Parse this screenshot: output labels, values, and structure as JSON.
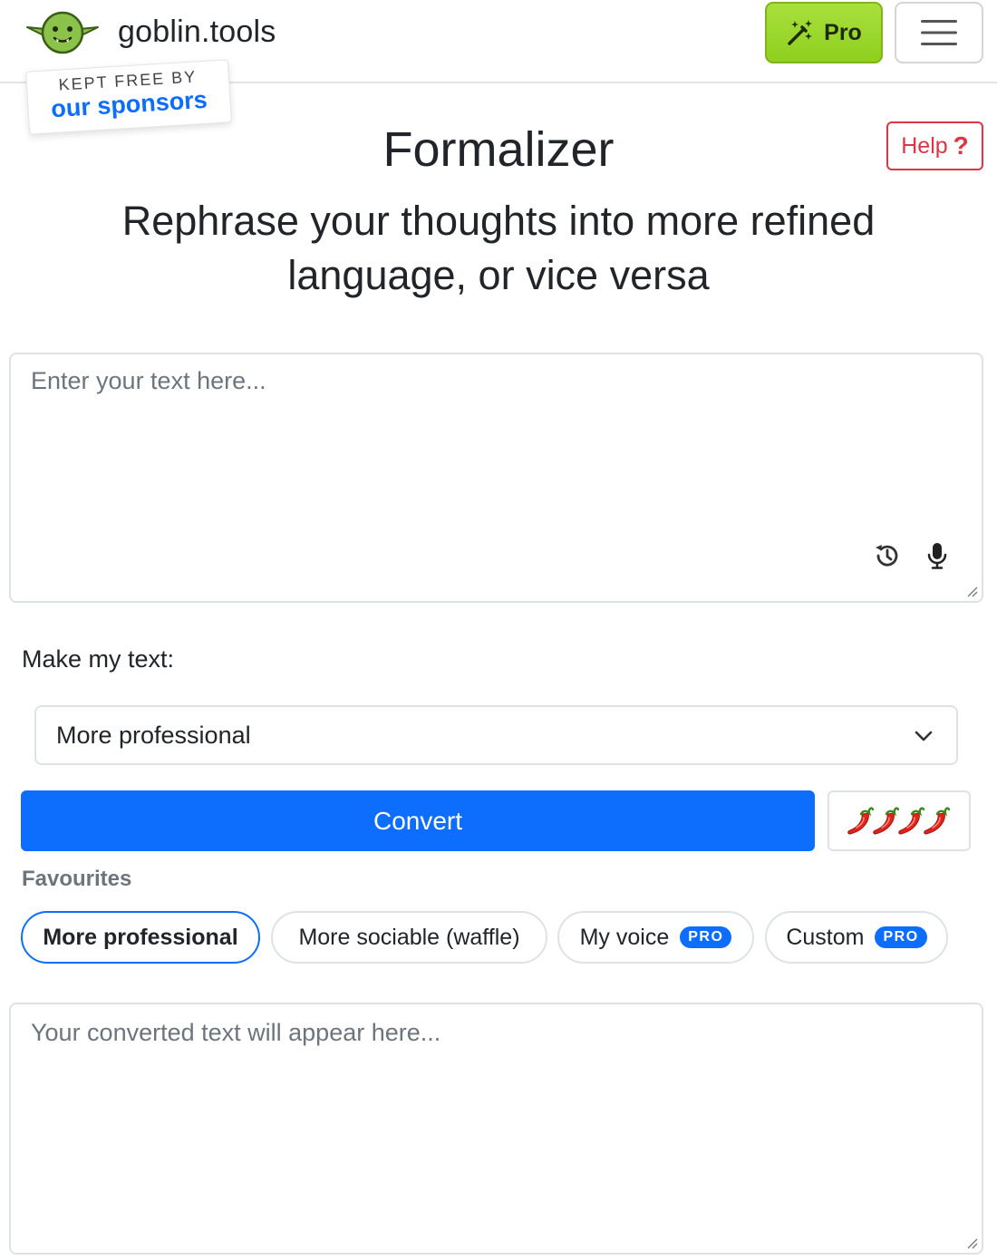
{
  "header": {
    "brand_name": "goblin.tools",
    "pro_label": "Pro",
    "sponsor_top": "KEPT FREE BY",
    "sponsor_bottom": "our sponsors",
    "colors": {
      "pro_green": "#8fcf1f",
      "accent_blue": "#0d6efd",
      "help_red": "#dc3545"
    }
  },
  "help": {
    "label": "Help",
    "icon": "?"
  },
  "page": {
    "title": "Formalizer",
    "subtitle": "Rephrase your thoughts into more refined language, or vice versa"
  },
  "input": {
    "placeholder": "Enter your text here...",
    "value": ""
  },
  "controls": {
    "make_label": "Make my text:",
    "selected_mode": "More professional",
    "convert_label": "Convert",
    "spiciness_level": 4
  },
  "favourites": {
    "label": "Favourites",
    "items": [
      {
        "label": "More professional",
        "active": true,
        "badge": ""
      },
      {
        "label": "More sociable (waffle)",
        "active": false,
        "badge": ""
      },
      {
        "label": "My voice",
        "active": false,
        "badge": "PRO"
      },
      {
        "label": "Custom",
        "active": false,
        "badge": "PRO"
      }
    ]
  },
  "output": {
    "placeholder": "Your converted text will appear here...",
    "value": ""
  }
}
